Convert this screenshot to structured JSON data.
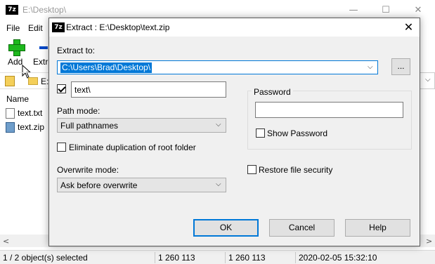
{
  "app": {
    "logo": "7z",
    "title": "E:\\Desktop\\",
    "window_buttons": {
      "minimize": "—",
      "maximize": "☐",
      "close": "✕"
    }
  },
  "menu": {
    "file": "File",
    "edit": "Edit"
  },
  "toolbar": {
    "add_label": "Add",
    "extract_label": "Extr"
  },
  "address": {
    "path_fragment": "E:"
  },
  "file_list": {
    "column_name": "Name",
    "files": [
      {
        "name": "text.txt",
        "icon": "text-file-icon"
      },
      {
        "name": "text.zip",
        "icon": "zip-archive-icon"
      }
    ]
  },
  "status": {
    "selected": "1 / 2 object(s) selected",
    "size": "1 260 113",
    "packed": "1 260 113",
    "modified": "2020-02-05 15:32:10"
  },
  "dialog": {
    "title": "Extract : E:\\Desktop\\text.zip",
    "close_glyph": "✕",
    "extract_to_label": "Extract to:",
    "extract_to_value": "C:\\Users\\Brad\\Desktop\\",
    "browse_label": "...",
    "subfolder_checked": true,
    "subfolder_value": "text\\",
    "path_mode_label": "Path mode:",
    "path_mode_value": "Full pathnames",
    "eliminate_dup_label": "Eliminate duplication of root folder",
    "eliminate_dup_checked": false,
    "overwrite_mode_label": "Overwrite mode:",
    "overwrite_mode_value": "Ask before overwrite",
    "password_group_title": "Password",
    "password_value": "",
    "show_password_label": "Show Password",
    "show_password_checked": false,
    "restore_security_label": "Restore file security",
    "restore_security_checked": false,
    "ok_label": "OK",
    "cancel_label": "Cancel",
    "help_label": "Help"
  },
  "colors": {
    "accent": "#0078d7",
    "dialog_bg": "#f0f0f0",
    "add_icon_green": "#1db81d"
  }
}
